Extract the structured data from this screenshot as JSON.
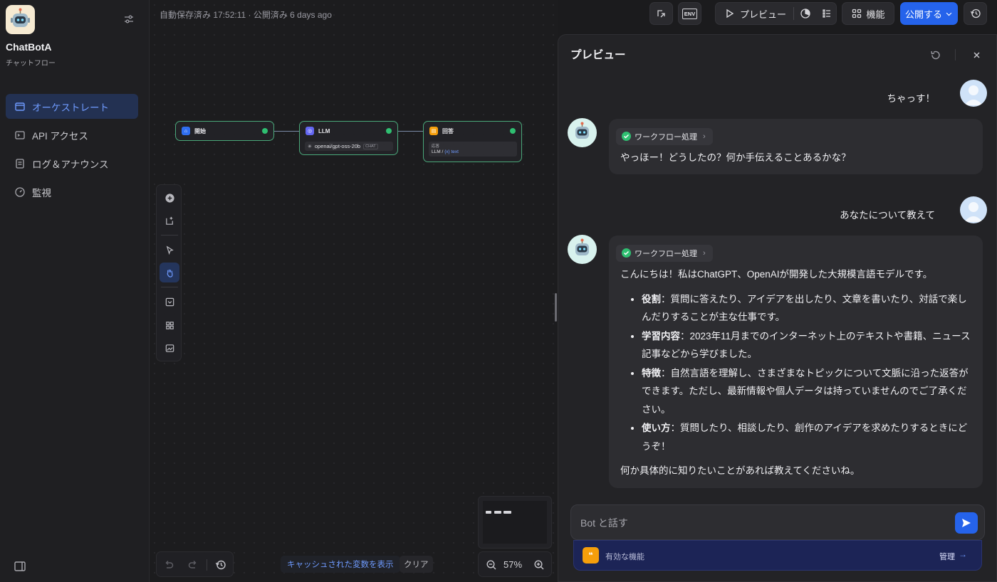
{
  "app": {
    "name": "ChatBotA",
    "subtitle": "チャットフロー"
  },
  "sidebar": {
    "items": [
      {
        "label": "オーケストレート",
        "icon": "window-icon",
        "active": true
      },
      {
        "label": "API アクセス",
        "icon": "terminal-icon",
        "active": false
      },
      {
        "label": "ログ＆アナウンス",
        "icon": "document-icon",
        "active": false
      },
      {
        "label": "監視",
        "icon": "gauge-icon",
        "active": false
      }
    ]
  },
  "header": {
    "autosave": "自動保存済み 17:52:11 · 公開済み 6 days ago",
    "preview_label": "プレビュー",
    "features_label": "機能",
    "publish_label": "公開する",
    "env_label": "ENV"
  },
  "workflow": {
    "nodes": [
      {
        "title": "開始"
      },
      {
        "title": "LLM",
        "model": "openai/gpt-oss-20b",
        "tag": "CHAT"
      },
      {
        "title": "回答",
        "field_label": "応答",
        "value_source": "LLM /",
        "value_var": "{x} text"
      }
    ]
  },
  "canvas_controls": {
    "cache_label": "キャッシュされた変数を表示",
    "clear_label": "クリア",
    "zoom": "57%"
  },
  "preview": {
    "title": "プレビュー",
    "messages": [
      {
        "role": "user",
        "text": "ちゃっす！"
      },
      {
        "role": "bot",
        "workflow_label": "ワークフロー処理",
        "text": "やっほー！どうしたの？何か手伝えることあるかな？"
      },
      {
        "role": "user",
        "text": "あなたについて教えて"
      },
      {
        "role": "bot",
        "workflow_label": "ワークフロー処理",
        "intro": "こんにちは！私はChatGPT、OpenAIが開発した大規模言語モデルです。",
        "bullets": [
          {
            "term": "役割",
            "text": "：質問に答えたり、アイデアを出したり、文章を書いたり、対話で楽しんだりすることが主な仕事です。"
          },
          {
            "term": "学習内容",
            "text": "：2023年11月までのインターネット上のテキストや書籍、ニュース記事などから学びました。"
          },
          {
            "term": "特徴",
            "text": "：自然言語を理解し、さまざまなトピックについて文脈に沿った返答ができます。ただし、最新情報や個人データは持っていませんのでご了承ください。"
          },
          {
            "term": "使い方",
            "text": "：質問したり、相談したり、創作のアイデアを求めたりするときにどうぞ！"
          }
        ],
        "outro": "何か具体的に知りたいことがあれば教えてくださいね。"
      }
    ],
    "input_placeholder": "Bot と話す",
    "features_label": "有効な機能",
    "manage_label": "管理",
    "manage_arrow": "→"
  }
}
